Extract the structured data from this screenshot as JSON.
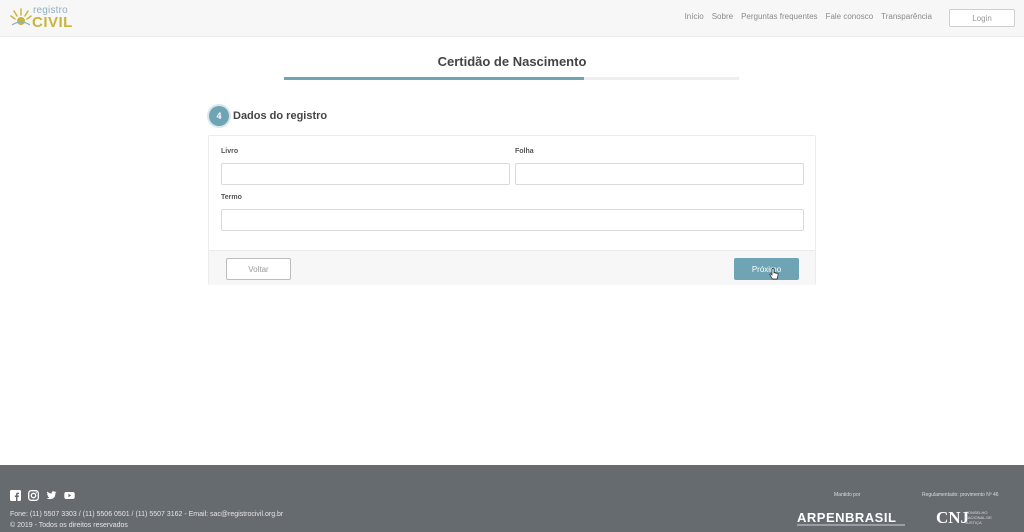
{
  "header": {
    "logo": {
      "line1": "registro",
      "line2": "CIVIL"
    },
    "nav": [
      "Início",
      "Sobre",
      "Perguntas frequentes",
      "Fale conosco",
      "Transparência"
    ],
    "login_label": "Login"
  },
  "page": {
    "title": "Certidão de Nascimento",
    "progress_fraction": 0.66
  },
  "step": {
    "number": "4",
    "title": "Dados do registro"
  },
  "form": {
    "livro_label": "Livro",
    "livro_value": "",
    "folha_label": "Folha",
    "folha_value": "",
    "termo_label": "Termo",
    "termo_value": ""
  },
  "actions": {
    "back_label": "Voltar",
    "next_label": "Próximo"
  },
  "footer": {
    "contact": "Fone: (11) 5507 3303 / (11) 5506 0501 / (11) 5507 3162 - Email: sac@registrocivil.org.br",
    "copyright": "© 2019 - Todos os direitos reservados",
    "mantido_por": "Mantido por",
    "regulamentado": "Regulamentado: provimento Nº 46",
    "arpen": "ARPENBRASIL",
    "cnj": "CNJ",
    "cnj_sub": "CONSELHO NACIONAL DE JUSTIÇA",
    "social_icons": [
      "facebook-icon",
      "instagram-icon",
      "twitter-icon",
      "youtube-icon"
    ]
  },
  "colors": {
    "accent": "#6ea4b4",
    "footer_bg": "#666b70",
    "logo_gold": "#c9b53a"
  }
}
